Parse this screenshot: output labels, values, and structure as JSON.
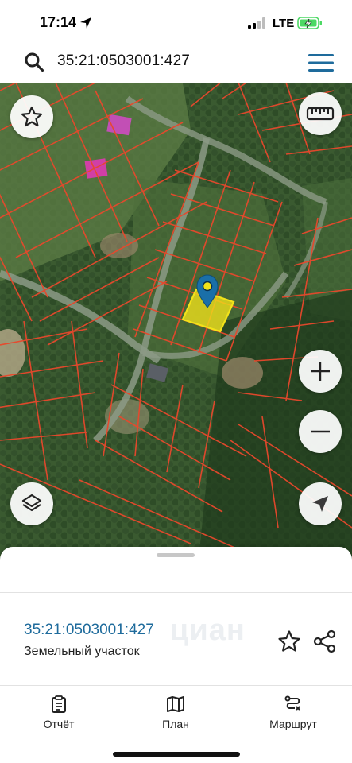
{
  "status_bar": {
    "time": "17:14",
    "network": "LTE",
    "icons": [
      "location-arrow-icon",
      "signal-icon",
      "battery-charging-icon"
    ]
  },
  "search": {
    "value": "35:21:0503001:427",
    "icon": "search-icon",
    "menu_icon": "hamburger-menu-icon"
  },
  "map": {
    "controls": [
      "star-icon",
      "ruler-icon",
      "zoom-in-icon",
      "zoom-out-icon",
      "layers-icon",
      "locate-arrow-icon"
    ],
    "zoom_in_label": "+",
    "zoom_out_label": "−",
    "highlight_color": "#f2e21a",
    "boundary_color": "#e8482c",
    "pin_color": "#1a6fa8"
  },
  "sheet": {
    "parcel_number": "35:21:0503001:427",
    "parcel_type": "Земельный участок",
    "watermark": "циан",
    "accent_color": "#1e6b9c"
  },
  "tabs": [
    {
      "label": "Отчёт",
      "icon": "report-clipboard-icon"
    },
    {
      "label": "План",
      "icon": "map-plan-icon"
    },
    {
      "label": "Маршрут",
      "icon": "route-icon"
    }
  ]
}
